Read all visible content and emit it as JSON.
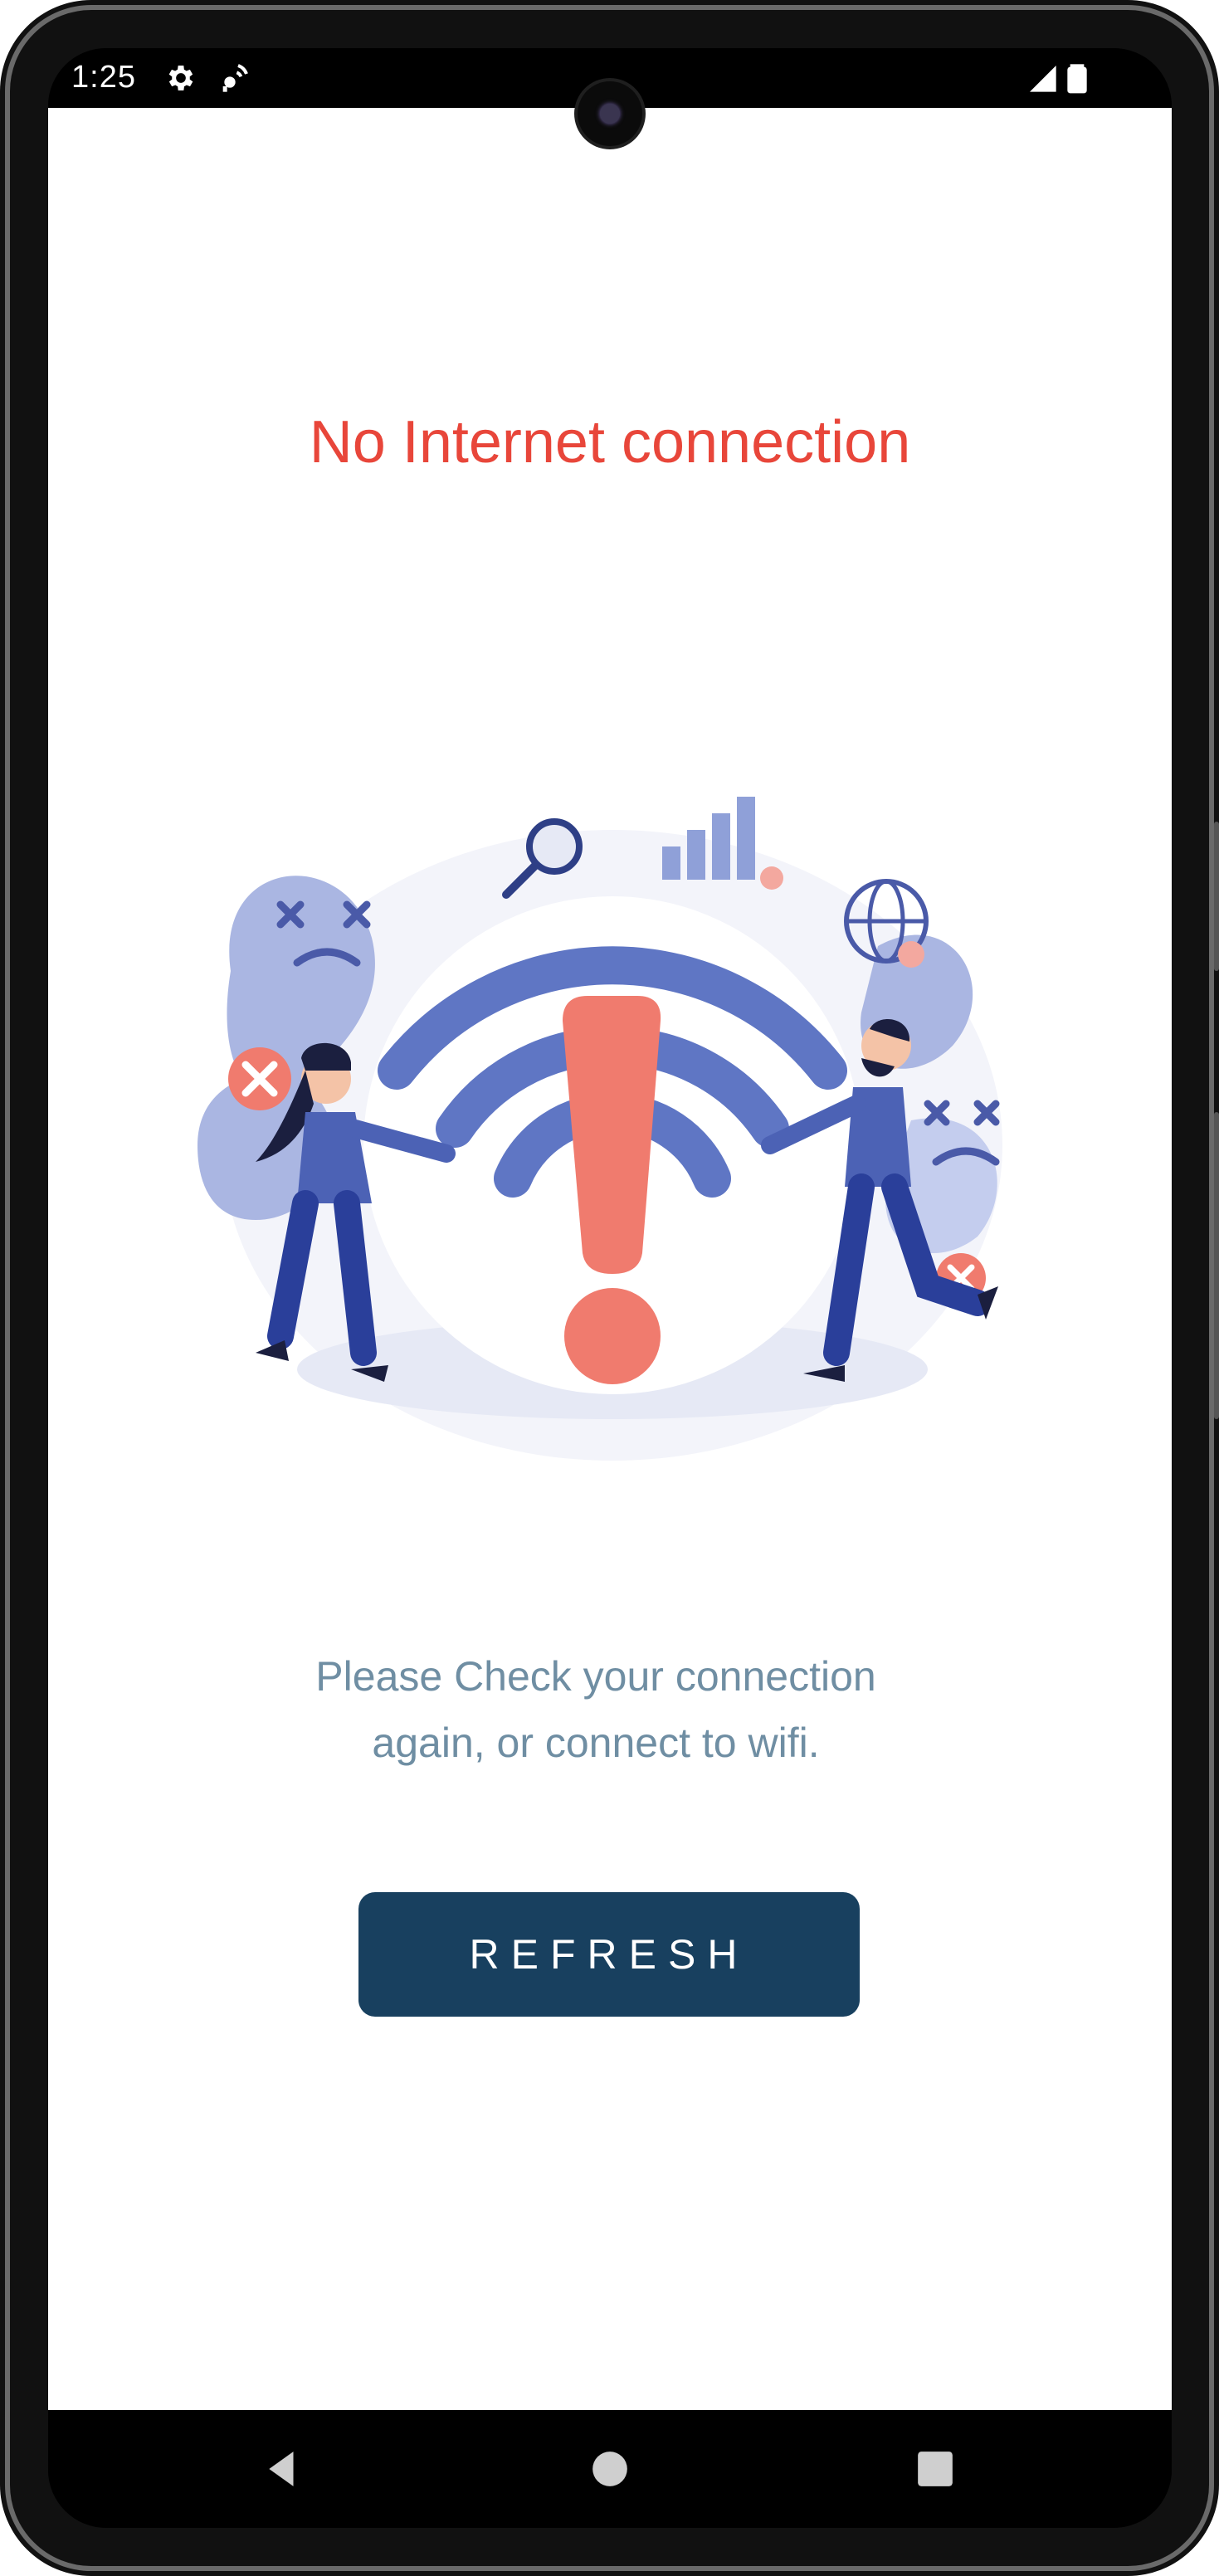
{
  "status_bar": {
    "time": "1:25",
    "icons": [
      "settings-icon",
      "signal-broadcast-icon",
      "cellular-signal-icon",
      "battery-icon"
    ]
  },
  "screen": {
    "title": "No Internet connection",
    "message": "Please Check your connection again, or connect to wifi.",
    "refresh_label": "REFRESH"
  },
  "navigation": {
    "buttons": [
      "back-icon",
      "home-icon",
      "recents-icon"
    ]
  },
  "colors": {
    "title": "#e8463a",
    "message": "#6f8ea3",
    "button": "#18405f",
    "illustration_primary": "#5f76c4",
    "illustration_alert": "#f07b6e"
  }
}
